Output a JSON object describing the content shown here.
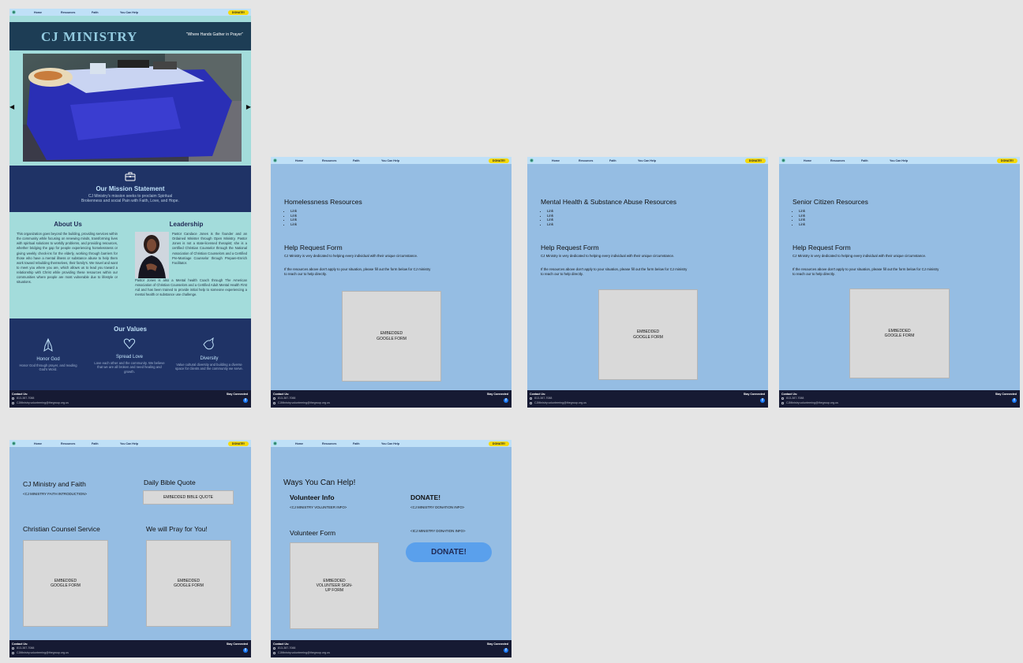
{
  "nav": {
    "links": [
      "Home",
      "Resources",
      "Faith",
      "You Can Help"
    ],
    "donate_label": "DONATE!"
  },
  "footer": {
    "contact_label": "Contact Us:",
    "phone": "813-387-7088",
    "email": "CJMinistry.volunteering@thegroup.org.us",
    "stay_connected": "Stay Connected",
    "facebook_icon": "f"
  },
  "home": {
    "title": "CJ MINISTRY",
    "tagline": "\"Where Hands Gather in Prayer\"",
    "carousel_prev": "◀",
    "carousel_next": "▶",
    "mission": {
      "title": "Our Mission Statement",
      "text_line1": "CJ Ministry's mission seeks to proclaim Spiritual",
      "text_line2": "Brokenness and social Pain with Faith, Love, and Hope."
    },
    "about": {
      "title": "About Us",
      "text": "This organization goes beyond the building, providing services within the community while focusing on renewing minds, transforming lives with spiritual solutions to worldly problems, and providing resources, whether bridging the gap for people experiencing homelessness or giving weekly check-ins for the elderly, working through barriers for those who have a mental illness or substance abuse to help them work toward rebuilding themselves, their family's. We travel and want to meet you where you are, which allows us to lead you toward a relationship with Christ while providing these resources within our communities where people are most vulnerable due to lifestyle or situations."
    },
    "leadership": {
      "title": "Leadership",
      "text1": "Pastor Candace Jones is the founder and an Ordained Minister through Open Ministry. Pastor Jones is not a state-licensed therapist; she is a certified Christian Counselor through the National Association of Christian Counselors and a Certified Pre-Marriage Counselor through Prepare-Enrich Facilitator.",
      "text2": "Pastor Jones is also a Mental health Coach through The American Association of Christian Counselors and a Certified Adult Mental Health First Aid and has been trained to provide initial help to someone experiencing a mental health or substance use challenge."
    },
    "values": {
      "title": "Our Values",
      "items": [
        {
          "title": "Honor God",
          "text": "Honor God through prayer, and reading God's Word."
        },
        {
          "title": "Spread Love",
          "text": "Love each other and the community. We believe that we are all broken and need healing and growth."
        },
        {
          "title": "Diversity",
          "text": "Value cultural diversity and building a diverse space for clients and the community we serve."
        }
      ]
    }
  },
  "resource_pages": [
    {
      "title": "Homelessness Resources"
    },
    {
      "title": "Mental Health & Substance Abuse Resources"
    },
    {
      "title": "Senior Citizen Resources"
    }
  ],
  "resource_common": {
    "links": [
      "Link",
      "Link",
      "Link",
      "Link"
    ],
    "help_title": "Help Request Form",
    "help_text1": "CJ Ministry is very dedicated to helping every individual with their unique circumstance.",
    "help_text2": "If the resources above don't apply to your situation, please fill out the form below for CJ ministry to reach our to help directly.",
    "form_label": "EMBEDDED GOOGLE FORM"
  },
  "faith": {
    "title": "CJ Ministry and Faith",
    "intro": "<CJ MINISTRY FAITH INTRODUCTION>",
    "quote_title": "Daily Bible Quote",
    "quote_box": "EMBEDDED BIBLE QUOTE",
    "counsel_title": "Christian Counsel Service",
    "counsel_form": "EMBEDDED GOOGLE FORM",
    "pray_title": "We will Pray for You!",
    "pray_form": "EMBEDDED GOOGLE FORM"
  },
  "help": {
    "title": "Ways You Can Help!",
    "volunteer_title": "Volunteer Info",
    "volunteer_info": "<CJ MINISTRY VOLUNTEER INFO>",
    "donate_title": "DONATE!",
    "donation_info1": "<CJ MINISTRY DONATION INFO>",
    "donation_info2": "<ICJ MINISTRY DONATION INFO>",
    "volunteer_form_title": "Volunteer Form",
    "volunteer_form": "EMBEDDED VOLUNTEER SIGN-UP FORM",
    "donate_button": "DONATE!"
  },
  "colors": {
    "nav_bg": "#bfe0f7",
    "donate_yellow": "#f5d90a",
    "header_dark": "#1d3d55",
    "teal_bg": "#a3dcdb",
    "navy": "#1f3366",
    "page_blue": "#95bde3",
    "footer": "#161a33"
  }
}
